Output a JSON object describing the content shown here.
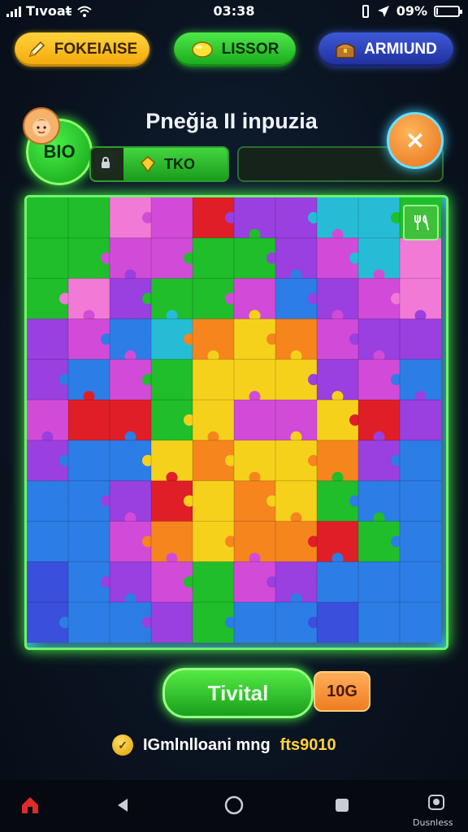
{
  "status_bar": {
    "carrier": "Tıvoaŧ",
    "time": "03:38",
    "battery": "09%",
    "battery_level": 0.09
  },
  "top_buttons": {
    "left": {
      "label": "FOKEIAISE",
      "icon": "pencil-icon"
    },
    "center": {
      "label": "LISSOR",
      "icon": "lemon-icon"
    },
    "right": {
      "label": "ARMIUND",
      "icon": "treasure-chest-icon"
    }
  },
  "header": {
    "title": "Pneğia II inpuzia",
    "badge_label": "BIO",
    "progress_label": "TKO",
    "close_glyph": "✕"
  },
  "board": {
    "rows": 11,
    "cols": 10,
    "colors": {
      "G": "#1fbe2a",
      "P": "#9a3fe0",
      "M": "#d24bd8",
      "K": "#f07ad6",
      "R": "#e01e28",
      "O": "#f6851e",
      "Y": "#f6d11c",
      "B": "#2d7de6",
      "C": "#26bcd6",
      "D": "#3a4fdc"
    },
    "grid": [
      "GGKMRPPCCG",
      "GGMMGGPMCK",
      "GKPGGMBPMK",
      "PMBCOYOMPP",
      "PBMGYYYPMB",
      "MRRGYMMYRP",
      "PBBYOYYOPB",
      "BBPRYOYGBB",
      "BBMOYOORGB",
      "DBPMGMPBBB",
      "DBBPGBBDBB"
    ]
  },
  "board_button_icon": "fork-knife-icon",
  "actions": {
    "primary_label": "Tivital",
    "counter": "10G"
  },
  "footer_info": {
    "text": "IGmlnlloani mng",
    "highlight": "fts9010",
    "icon": "coin-icon"
  },
  "nav_bar": {
    "caption": "Dusnless"
  }
}
